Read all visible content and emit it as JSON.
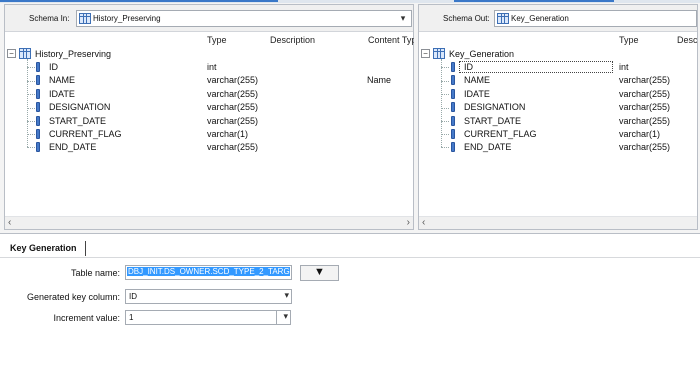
{
  "left_panel": {
    "schema_label": "Schema In:",
    "schema_value": "History_Preserving",
    "columns": [
      "Type",
      "Description",
      "Content Typ"
    ],
    "root": "History_Preserving",
    "rows": [
      {
        "name": "ID",
        "type": "int",
        "content_type": ""
      },
      {
        "name": "NAME",
        "type": "varchar(255)",
        "content_type": "Name"
      },
      {
        "name": "IDATE",
        "type": "varchar(255)",
        "content_type": ""
      },
      {
        "name": "DESIGNATION",
        "type": "varchar(255)",
        "content_type": ""
      },
      {
        "name": "START_DATE",
        "type": "varchar(255)",
        "content_type": ""
      },
      {
        "name": "CURRENT_FLAG",
        "type": "varchar(1)",
        "content_type": ""
      },
      {
        "name": "END_DATE",
        "type": "varchar(255)",
        "content_type": ""
      }
    ]
  },
  "right_panel": {
    "schema_label": "Schema Out:",
    "schema_value": "Key_Generation",
    "columns": [
      "Type",
      "Descr"
    ],
    "root": "Key_Generation",
    "rows": [
      {
        "name": "ID",
        "type": "int"
      },
      {
        "name": "NAME",
        "type": "varchar(255)"
      },
      {
        "name": "IDATE",
        "type": "varchar(255)"
      },
      {
        "name": "DESIGNATION",
        "type": "varchar(255)"
      },
      {
        "name": "START_DATE",
        "type": "varchar(255)"
      },
      {
        "name": "CURRENT_FLAG",
        "type": "varchar(1)"
      },
      {
        "name": "END_DATE",
        "type": "varchar(255)"
      }
    ]
  },
  "bottom": {
    "tab_label": "Key Generation",
    "table_name_label": "Table name:",
    "table_name_value": "DBJ_INIT.DS_OWNER.SCD_TYPE_2_TARGET",
    "key_column_label": "Generated key column:",
    "key_column_value": "ID",
    "increment_label": "Increment value:",
    "increment_value": "1"
  },
  "icons": {
    "scroll_left": "‹",
    "scroll_right": "›",
    "dropdown": "▾",
    "expander_minus": "−",
    "browse_down": "▼"
  },
  "colors": {
    "selection": "#3399ff",
    "accent_blue": "#3a78c8"
  }
}
